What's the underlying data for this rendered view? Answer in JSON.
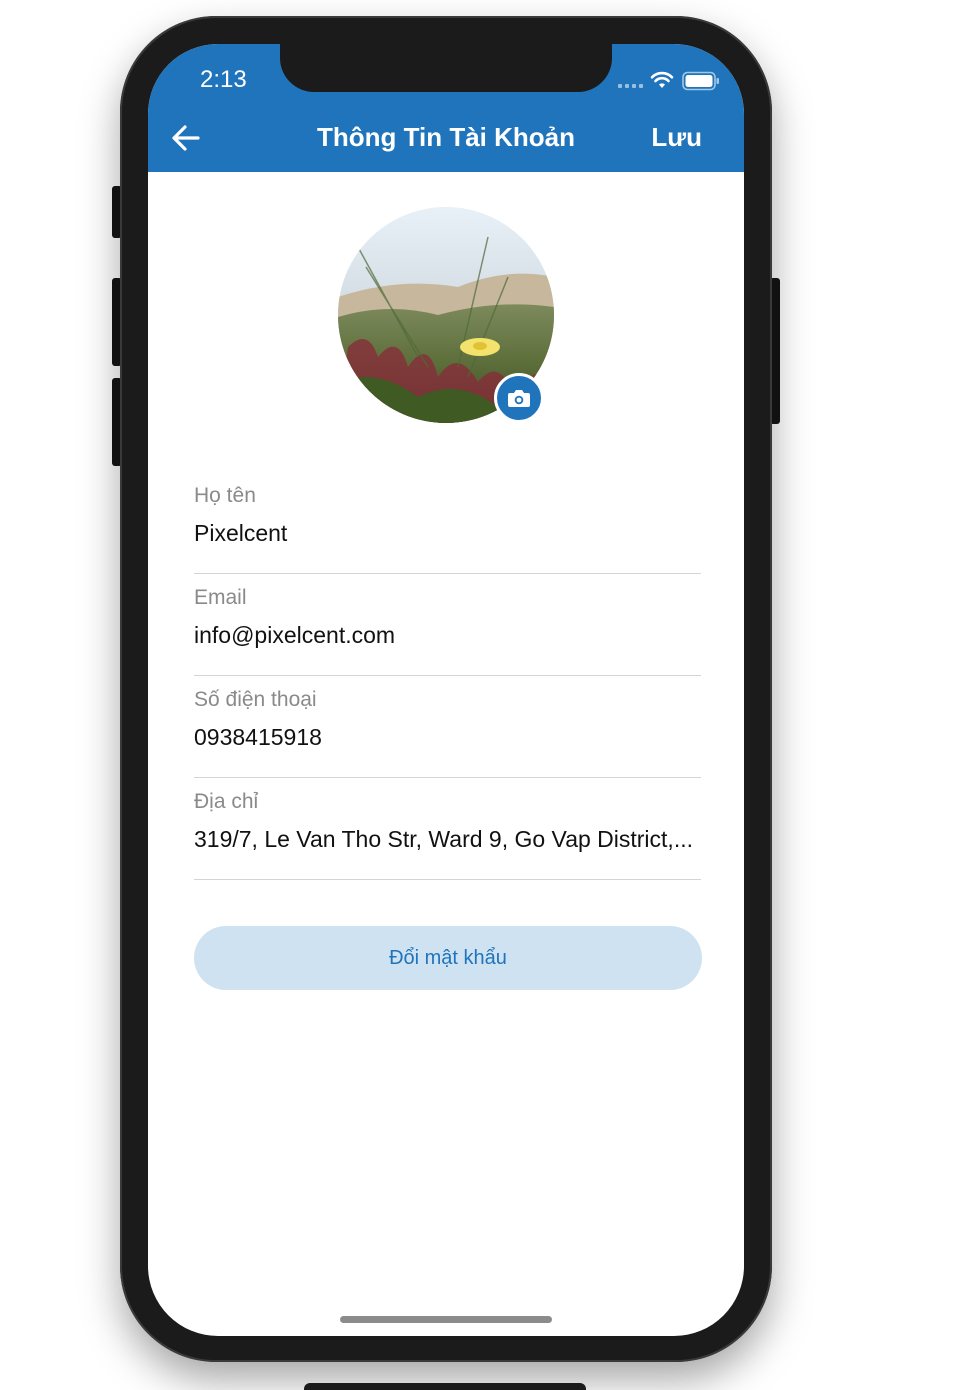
{
  "status_bar": {
    "time": "2:13"
  },
  "header": {
    "title": "Thông Tin Tài Khoản",
    "save_label": "Lưu"
  },
  "profile": {
    "fields": [
      {
        "label": "Họ tên",
        "value": "Pixelcent"
      },
      {
        "label": "Email",
        "value": "info@pixelcent.com"
      },
      {
        "label": "Số điện thoại",
        "value": "0938415918"
      },
      {
        "label": "Địa chỉ",
        "value": "319/7, Le Van Tho Str, Ward 9, Go Vap District,..."
      }
    ],
    "change_password_label": "Đổi mật khẩu"
  },
  "colors": {
    "primary": "#1f74bb",
    "button_bg": "#cfe2f1",
    "label": "#8a8a8a",
    "divider": "#d4d4d4"
  },
  "icons": {
    "back": "arrow-left-icon",
    "camera": "camera-icon",
    "wifi": "wifi-icon",
    "battery": "battery-icon",
    "signal": "signal-icon"
  }
}
